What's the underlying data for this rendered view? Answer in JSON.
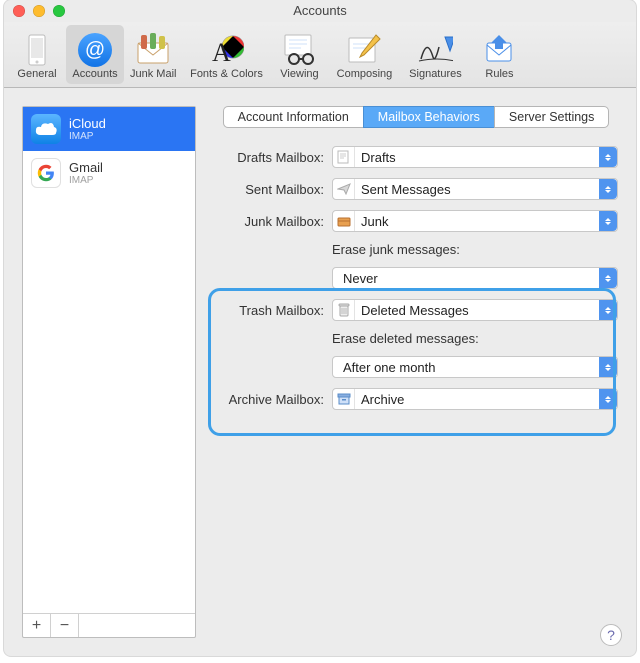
{
  "window": {
    "title": "Accounts"
  },
  "toolbar": {
    "items": [
      {
        "label": "General"
      },
      {
        "label": "Accounts"
      },
      {
        "label": "Junk Mail"
      },
      {
        "label": "Fonts & Colors"
      },
      {
        "label": "Viewing"
      },
      {
        "label": "Composing"
      },
      {
        "label": "Signatures"
      },
      {
        "label": "Rules"
      }
    ],
    "selected_index": 1
  },
  "sidebar": {
    "accounts": [
      {
        "name": "iCloud",
        "sub": "IMAP",
        "selected": true
      },
      {
        "name": "Gmail",
        "sub": "IMAP",
        "selected": false
      }
    ],
    "add_label": "+",
    "remove_label": "−"
  },
  "tabs": {
    "items": [
      {
        "label": "Account Information"
      },
      {
        "label": "Mailbox Behaviors"
      },
      {
        "label": "Server Settings"
      }
    ],
    "selected_index": 1
  },
  "form": {
    "drafts_label": "Drafts Mailbox:",
    "drafts_value": "Drafts",
    "sent_label": "Sent Mailbox:",
    "sent_value": "Sent Messages",
    "junk_label": "Junk Mailbox:",
    "junk_value": "Junk",
    "erase_junk_label": "Erase junk messages:",
    "erase_junk_value": "Never",
    "trash_label": "Trash Mailbox:",
    "trash_value": "Deleted Messages",
    "erase_deleted_label": "Erase deleted messages:",
    "erase_deleted_value": "After one month",
    "archive_label": "Archive Mailbox:",
    "archive_value": "Archive"
  },
  "help_label": "?"
}
